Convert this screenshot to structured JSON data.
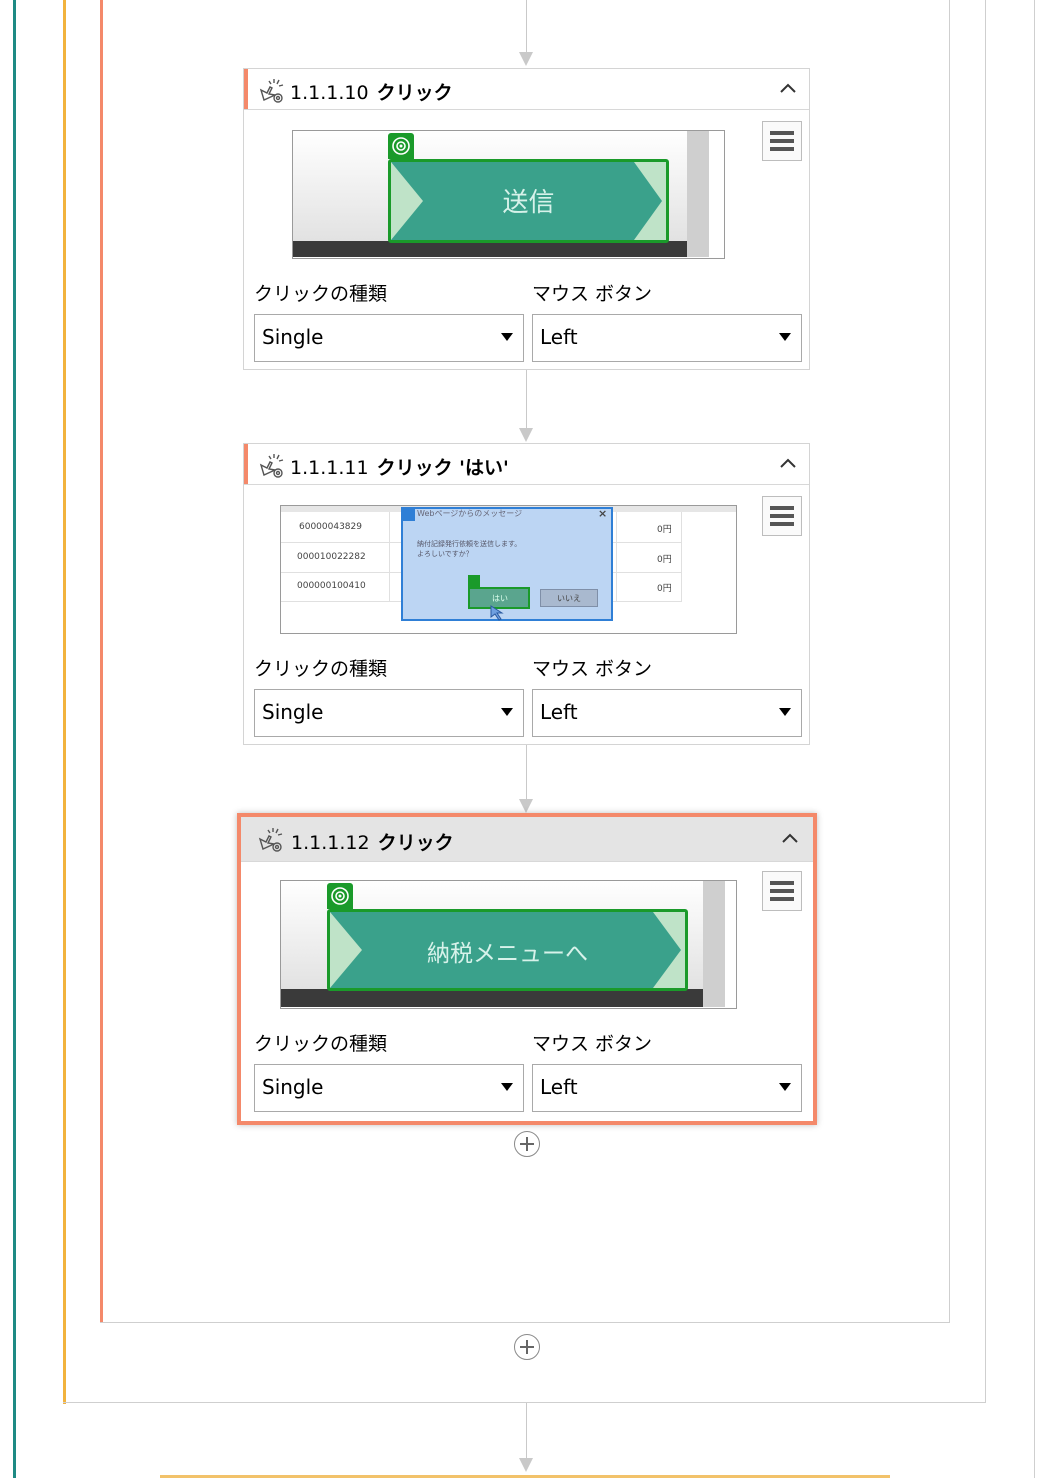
{
  "activities": [
    {
      "number": "1.1.1.10",
      "title": "クリック",
      "screenshot_button_text": "送信",
      "click_type_label": "クリックの種類",
      "click_type_value": "Single",
      "mouse_button_label": "マウス ボタン",
      "mouse_button_value": "Left"
    },
    {
      "number": "1.1.1.11",
      "title": "クリック 'はい'",
      "dialog": {
        "title": "Webページからのメッセージ",
        "message_line1": "納付記録発行依頼を送信します。",
        "message_line2": "よろしいですか？",
        "yes": "はい",
        "no": "いいえ",
        "close": "×"
      },
      "rows": [
        {
          "id": "60000043829",
          "amount": "0円"
        },
        {
          "id": "000010022282",
          "amount": "0円"
        },
        {
          "id": "000000100410",
          "amount": "0円"
        }
      ],
      "click_type_label": "クリックの種類",
      "click_type_value": "Single",
      "mouse_button_label": "マウス ボタン",
      "mouse_button_value": "Left"
    },
    {
      "number": "1.1.1.12",
      "title": "クリック",
      "screenshot_button_text": "納税メニューへ",
      "click_type_label": "クリックの種類",
      "click_type_value": "Single",
      "mouse_button_label": "マウス ボタン",
      "mouse_button_value": "Left"
    }
  ],
  "colors": {
    "accent_orange": "#f4896a",
    "teal_border": "#1e8a84",
    "yellow_border": "#f2b33d",
    "button_teal": "#3aa18b",
    "target_green": "#1a9a2a",
    "dialog_blue": "#bcd5f3"
  },
  "icons": {
    "activity": "click-activity-icon",
    "collapse": "chevron-up-icon",
    "menu": "hamburger-menu-icon",
    "add": "plus-circle-icon",
    "dropdown": "caret-down-icon"
  }
}
